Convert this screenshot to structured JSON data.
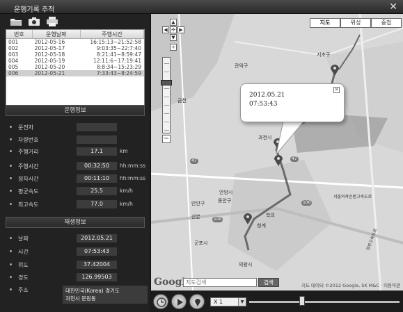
{
  "window": {
    "title": "운행기록 추적",
    "close_glyph": "✕"
  },
  "records": {
    "headers": [
      "번호",
      "운행날짜",
      "주행시간"
    ],
    "rows": [
      [
        "001",
        "2012-05-16",
        "16:15:13~21:52:58"
      ],
      [
        "002",
        "2012-05-17",
        "9:03:35~22:7:40"
      ],
      [
        "003",
        "2012-05-18",
        "8:21:41~8:59:47"
      ],
      [
        "004",
        "2012-05-19",
        "12:11:6~17:19:41"
      ],
      [
        "005",
        "2012-05-20",
        "8:8:34~15:23:29"
      ],
      [
        "006",
        "2012-05-21",
        "7:33:43~8:24:59"
      ]
    ],
    "selected_index": 5
  },
  "driving_info": {
    "header": "운행정보",
    "driver_label": "운전자",
    "driver_value": "",
    "vehicle_label": "차량번호",
    "vehicle_value": "",
    "distance_label": "주행거리",
    "distance_value": "17.1",
    "distance_unit": "km",
    "drive_time_label": "주행시간",
    "drive_time_value": "00:32:50",
    "drive_time_unit": "hh:mm:ss",
    "stop_time_label": "정차시간",
    "stop_time_value": "00:11:10",
    "stop_time_unit": "hh:mm:ss",
    "avg_speed_label": "평균속도",
    "avg_speed_value": "25.5",
    "avg_speed_unit": "km/h",
    "max_speed_label": "최고속도",
    "max_speed_value": "77.0",
    "max_speed_unit": "km/h"
  },
  "playback_info": {
    "header": "재생정보",
    "date_label": "날짜",
    "date_value": "2012.05.21",
    "time_label": "시간",
    "time_value": "07:53:43",
    "lat_label": "위도",
    "lat_value": "37.42004",
    "lng_label": "경도",
    "lng_value": "126.99503",
    "addr_label": "주소",
    "addr_line1": "대한민국(Korea) 경기도",
    "addr_line2": "과천시 문원동"
  },
  "map": {
    "tabs": [
      "지도",
      "위성",
      "중첩"
    ],
    "active_tab": 0,
    "popup_date": "2012.05.21",
    "popup_time": "07:53:43",
    "labels": {
      "seocho": "서초구",
      "gwanak": "관악구",
      "gwacheon": "과천시",
      "anyang": "안양시",
      "dongan": "동안구",
      "manan": "만안구",
      "sanbon": "산본",
      "gunpo": "군포시",
      "uiwang": "의왕시",
      "cheonggye": "청계",
      "hakui": "학의",
      "geumcheon": "금천",
      "seoul_ring": "서울외곽순환고속도로",
      "gyeongbu": "경부고속도로"
    },
    "google_logo": "Google",
    "search_placeholder": "지도검색",
    "search_button": "검색",
    "attribution": "지도 데이터 ©2012 Google, SK M&C · 이용약관"
  },
  "playback": {
    "speed": "X 1",
    "progress": 0.35
  },
  "colors": {
    "route": "#6a6a6a",
    "marker": "#4a4a4a",
    "panel": "#222222"
  }
}
